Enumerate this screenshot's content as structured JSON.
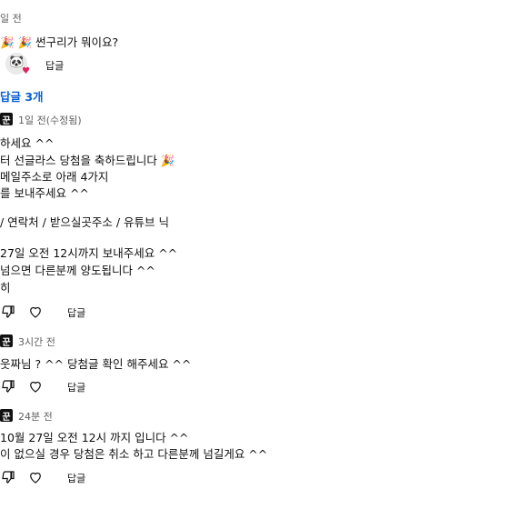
{
  "top": {
    "time": "일 전",
    "text": "🎉 🎉 썬구리가 뭐이요?",
    "reply_label": "답글"
  },
  "replies_toggle": "답글 3개",
  "comments": [
    {
      "avatar_char": "꾼",
      "time": "1일 전(수정됨)",
      "lines": [
        "하세요 ^^",
        "터 선글라스 당첨을 축하드립니다 🎉",
        "메일주소로 아래 4가지",
        "를 보내주세요 ^^",
        "",
        "/ 연락처 / 받으실곳주소 / 유튜브 닉",
        "",
        " 27일 오전 12시까지 보내주세요 ^^",
        "넘으면 다른분께 양도됩니다 ^^",
        "히"
      ],
      "reply_label": "답글"
    },
    {
      "avatar_char": "꾼",
      "time": "3시간 전",
      "lines": [
        "웃짜님 ? ^^ 당첨글 확인 해주세요 ^^"
      ],
      "reply_label": "답글"
    },
    {
      "avatar_char": "꾼",
      "time": "24분 전",
      "lines": [
        "10월 27일 오전 12시 까지 입니다 ^^",
        "이 없으실 경우 당첨은 취소 하고 다른분께 넘길게요 ^^"
      ],
      "reply_label": "답글"
    }
  ]
}
